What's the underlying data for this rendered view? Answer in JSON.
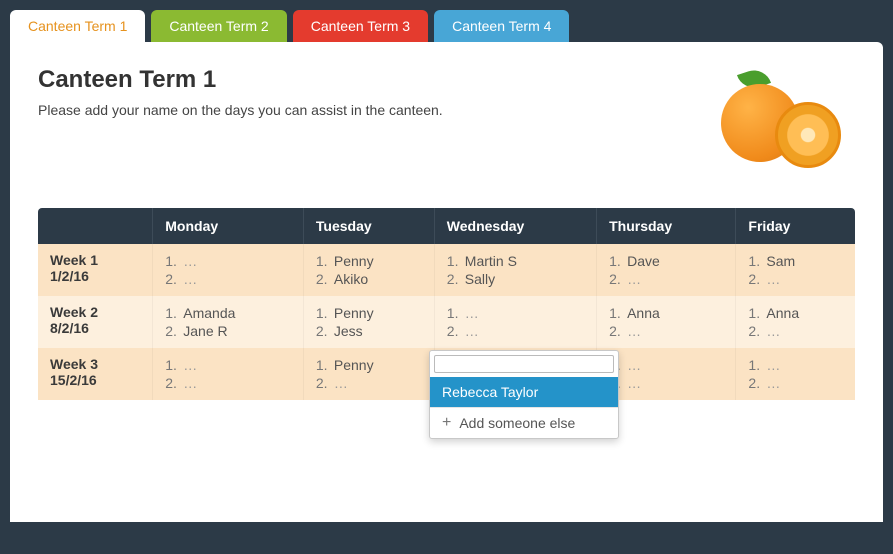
{
  "tabs": [
    {
      "label": "Canteen Term 1",
      "active": true
    },
    {
      "label": "Canteen Term 2"
    },
    {
      "label": "Canteen Term 3"
    },
    {
      "label": "Canteen Term 4"
    }
  ],
  "page": {
    "title": "Canteen Term 1",
    "intro": "Please add your name on the days you can assist in the canteen."
  },
  "columns": [
    "",
    "Monday",
    "Tuesday",
    "Wednesday",
    "Thursday",
    "Friday"
  ],
  "rows": [
    {
      "label": "Week 1",
      "date": "1/2/16",
      "cells": [
        [
          "…",
          "…"
        ],
        [
          "Penny",
          "Akiko"
        ],
        [
          "Martin S",
          "Sally"
        ],
        [
          "Dave",
          "…"
        ],
        [
          "Sam",
          "…"
        ]
      ]
    },
    {
      "label": "Week 2",
      "date": "8/2/16",
      "cells": [
        [
          "Amanda",
          "Jane R"
        ],
        [
          "Penny",
          "Jess"
        ],
        [
          "",
          "…"
        ],
        [
          "Anna",
          "…"
        ],
        [
          "Anna",
          "…"
        ]
      ]
    },
    {
      "label": "Week 3",
      "date": "15/2/16",
      "cells": [
        [
          "…",
          "…"
        ],
        [
          "Penny",
          "…"
        ],
        [
          "…",
          "…"
        ],
        [
          "…",
          "…"
        ],
        [
          "…",
          "…"
        ]
      ]
    }
  ],
  "dropdown": {
    "selected": "Rebecca Taylor",
    "add_label": "Add someone else"
  }
}
